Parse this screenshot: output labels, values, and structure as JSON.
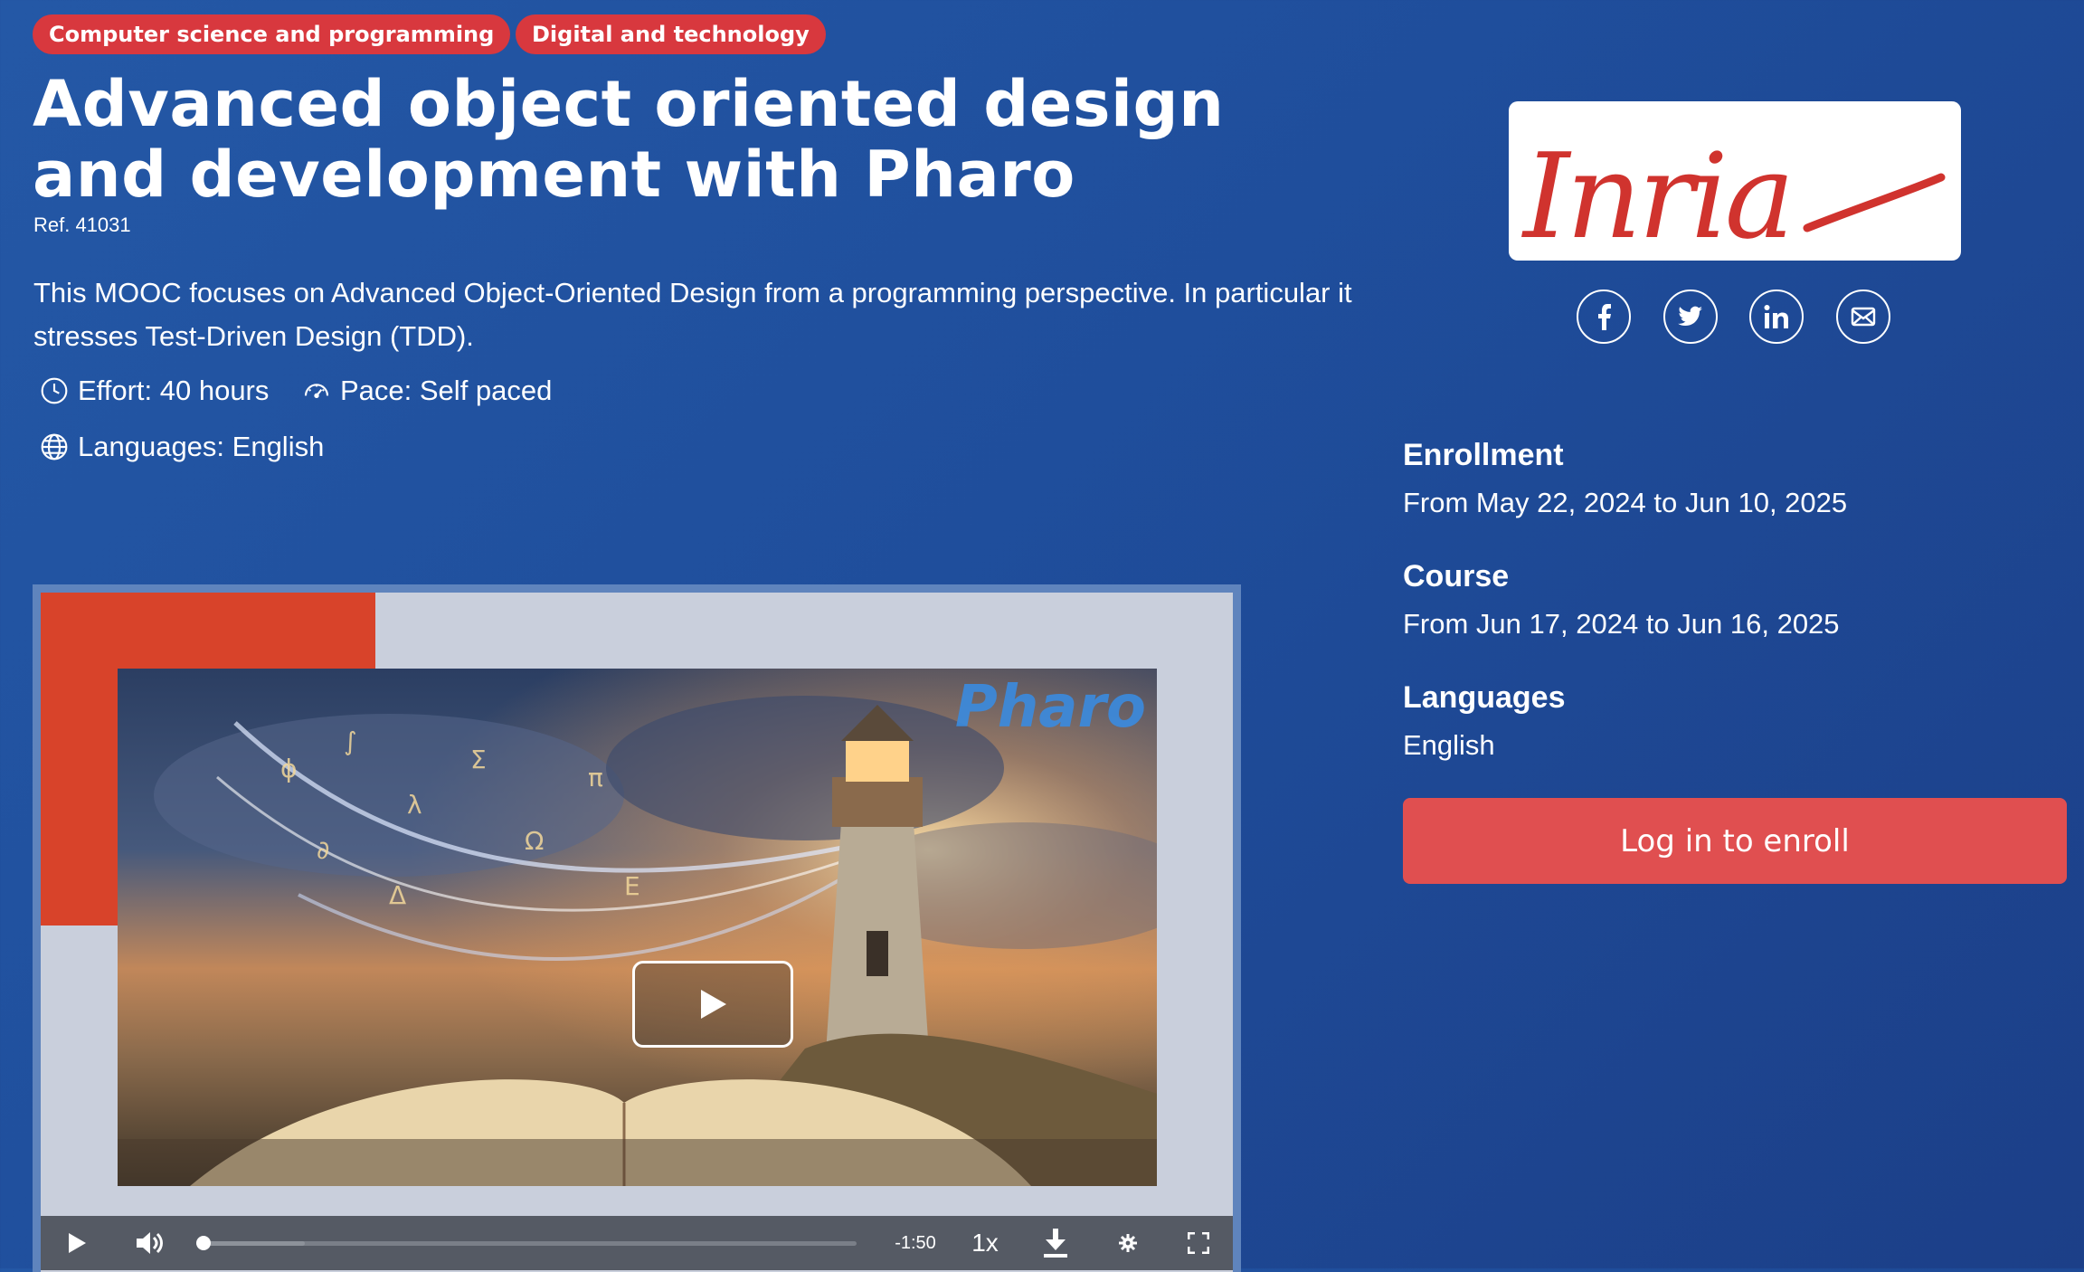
{
  "tags": [
    "Computer science and programming",
    "Digital and technology"
  ],
  "course": {
    "title": "Advanced object oriented design and development with Pharo",
    "ref": "Ref. 41031",
    "description": "This MOOC focuses on Advanced Object-Oriented Design from a programming perspective. In particular it stresses Test-Driven Design (TDD).",
    "effort": "Effort: 40 hours",
    "pace": "Pace: Self paced",
    "languages": "Languages: English"
  },
  "video": {
    "brand_overlay": "Pharo",
    "time_remaining": "-1:50",
    "speed": "1x",
    "progress": 0.0
  },
  "organization": {
    "logo_text": "Inria",
    "logo_color": "#d0332e"
  },
  "share": [
    "facebook-icon",
    "twitter-icon",
    "linkedin-icon",
    "mail-icon"
  ],
  "sidebar": {
    "enrollment_label": "Enrollment",
    "enrollment_dates": "From May 22, 2024 to Jun 10, 2025",
    "course_label": "Course",
    "course_dates": "From Jun 17, 2024 to Jun 16, 2025",
    "languages_label": "Languages",
    "languages_value": "English",
    "enroll_button": "Log in to enroll"
  },
  "colors": {
    "tag_bg": "#d8383e",
    "accent_orange": "#d8432a",
    "button_bg": "#e04f50"
  }
}
